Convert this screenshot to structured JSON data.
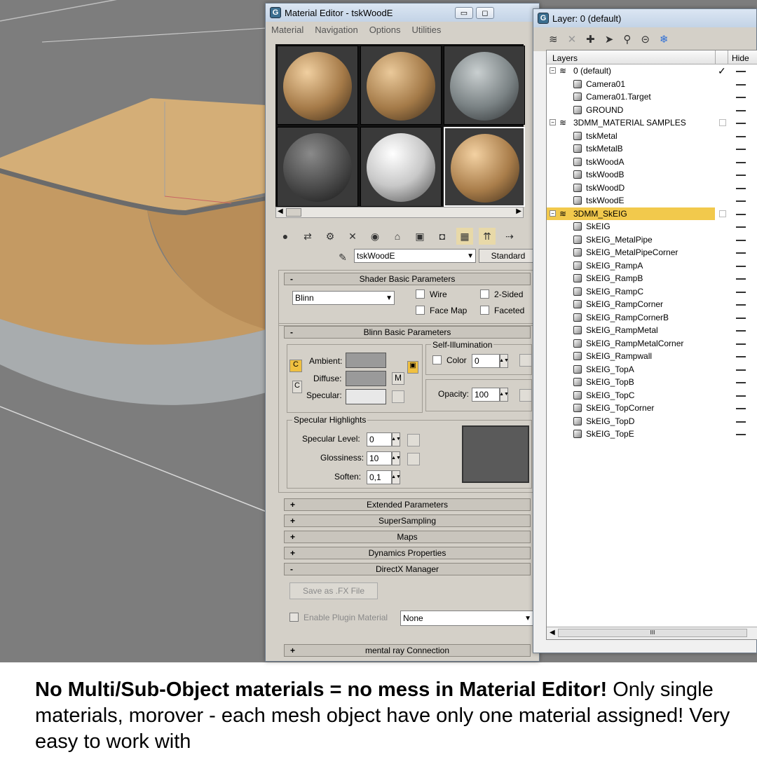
{
  "material_editor": {
    "title": "Material Editor - tskWoodE",
    "menu": [
      "Material",
      "Navigation",
      "Options",
      "Utilities"
    ],
    "material_name": "tskWoodE",
    "material_type_button": "Standard",
    "shader_rollout": {
      "toggle": "-",
      "title": "Shader Basic Parameters"
    },
    "shader_value": "Blinn",
    "wire_label": "Wire",
    "two_sided_label": "2-Sided",
    "face_map_label": "Face Map",
    "faceted_label": "Faceted",
    "blinn_rollout": {
      "toggle": "-",
      "title": "Blinn Basic Parameters"
    },
    "ambient_label": "Ambient:",
    "diffuse_label": "Diffuse:",
    "specular_label": "Specular:",
    "map_button_label": "M",
    "self_illum_title": "Self-Illumination",
    "color_label": "Color",
    "color_value": "0",
    "opacity_label": "Opacity:",
    "opacity_value": "100",
    "spec_highlights_title": "Specular Highlights",
    "spec_level_label": "Specular Level:",
    "spec_level_value": "0",
    "glossiness_label": "Glossiness:",
    "glossiness_value": "10",
    "soften_label": "Soften:",
    "soften_value": "0,1",
    "rollouts": [
      {
        "toggle": "+",
        "title": "Extended Parameters"
      },
      {
        "toggle": "+",
        "title": "SuperSampling"
      },
      {
        "toggle": "+",
        "title": "Maps"
      },
      {
        "toggle": "+",
        "title": "Dynamics Properties"
      },
      {
        "toggle": "-",
        "title": "DirectX Manager"
      }
    ],
    "save_fx_label": "Save as .FX File",
    "enable_plugin_label": "Enable Plugin Material",
    "plugin_value": "None",
    "mental_ray": {
      "toggle": "+",
      "title": "mental ray Connection"
    },
    "swatch_colors": {
      "ambient": "#9a9a9a",
      "diffuse": "#9a9a9a",
      "specular": "#e8e8e8",
      "highlight_preview": "#5a5a5a"
    }
  },
  "layer_manager": {
    "title": "Layer: 0 (default)",
    "col_layers": "Layers",
    "col_hide": "Hide",
    "scroll_mark": "III",
    "rows": [
      {
        "name": "0 (default)",
        "level": 0,
        "group": true,
        "check": "✓"
      },
      {
        "name": "Camera01",
        "level": 1
      },
      {
        "name": "Camera01.Target",
        "level": 1
      },
      {
        "name": "GROUND",
        "level": 1
      },
      {
        "name": "3DMM_MATERIAL SAMPLES",
        "level": 0,
        "group": true
      },
      {
        "name": "tskMetal",
        "level": 1
      },
      {
        "name": "tskMetalB",
        "level": 1
      },
      {
        "name": "tskWoodA",
        "level": 1
      },
      {
        "name": "tskWoodB",
        "level": 1
      },
      {
        "name": "tskWoodD",
        "level": 1
      },
      {
        "name": "tskWoodE",
        "level": 1
      },
      {
        "name": "3DMM_SkEIG",
        "level": 0,
        "group": true,
        "selected": true
      },
      {
        "name": "SkEIG",
        "level": 1
      },
      {
        "name": "SkEIG_MetalPipe",
        "level": 1
      },
      {
        "name": "SkEIG_MetalPipeCorner",
        "level": 1
      },
      {
        "name": "SkEIG_RampA",
        "level": 1
      },
      {
        "name": "SkEIG_RampB",
        "level": 1
      },
      {
        "name": "SkEIG_RampC",
        "level": 1
      },
      {
        "name": "SkEIG_RampCorner",
        "level": 1
      },
      {
        "name": "SkEIG_RampCornerB",
        "level": 1
      },
      {
        "name": "SkEIG_RampMetal",
        "level": 1
      },
      {
        "name": "SkEIG_RampMetalCorner",
        "level": 1
      },
      {
        "name": "SkEIG_Rampwall",
        "level": 1
      },
      {
        "name": "SkEIG_TopA",
        "level": 1
      },
      {
        "name": "SkEIG_TopB",
        "level": 1
      },
      {
        "name": "SkEIG_TopC",
        "level": 1
      },
      {
        "name": "SkEIG_TopCorner",
        "level": 1
      },
      {
        "name": "SkEIG_TopD",
        "level": 1
      },
      {
        "name": "SkEIG_TopE",
        "level": 1
      }
    ],
    "selected_color": "#f2c94c"
  },
  "caption": {
    "bold": "No Multi/Sub-Object materials = no mess in Material Editor!",
    "rest": " Only single materials, morover - each mesh object have only one material assigned! Very easy to work with"
  }
}
